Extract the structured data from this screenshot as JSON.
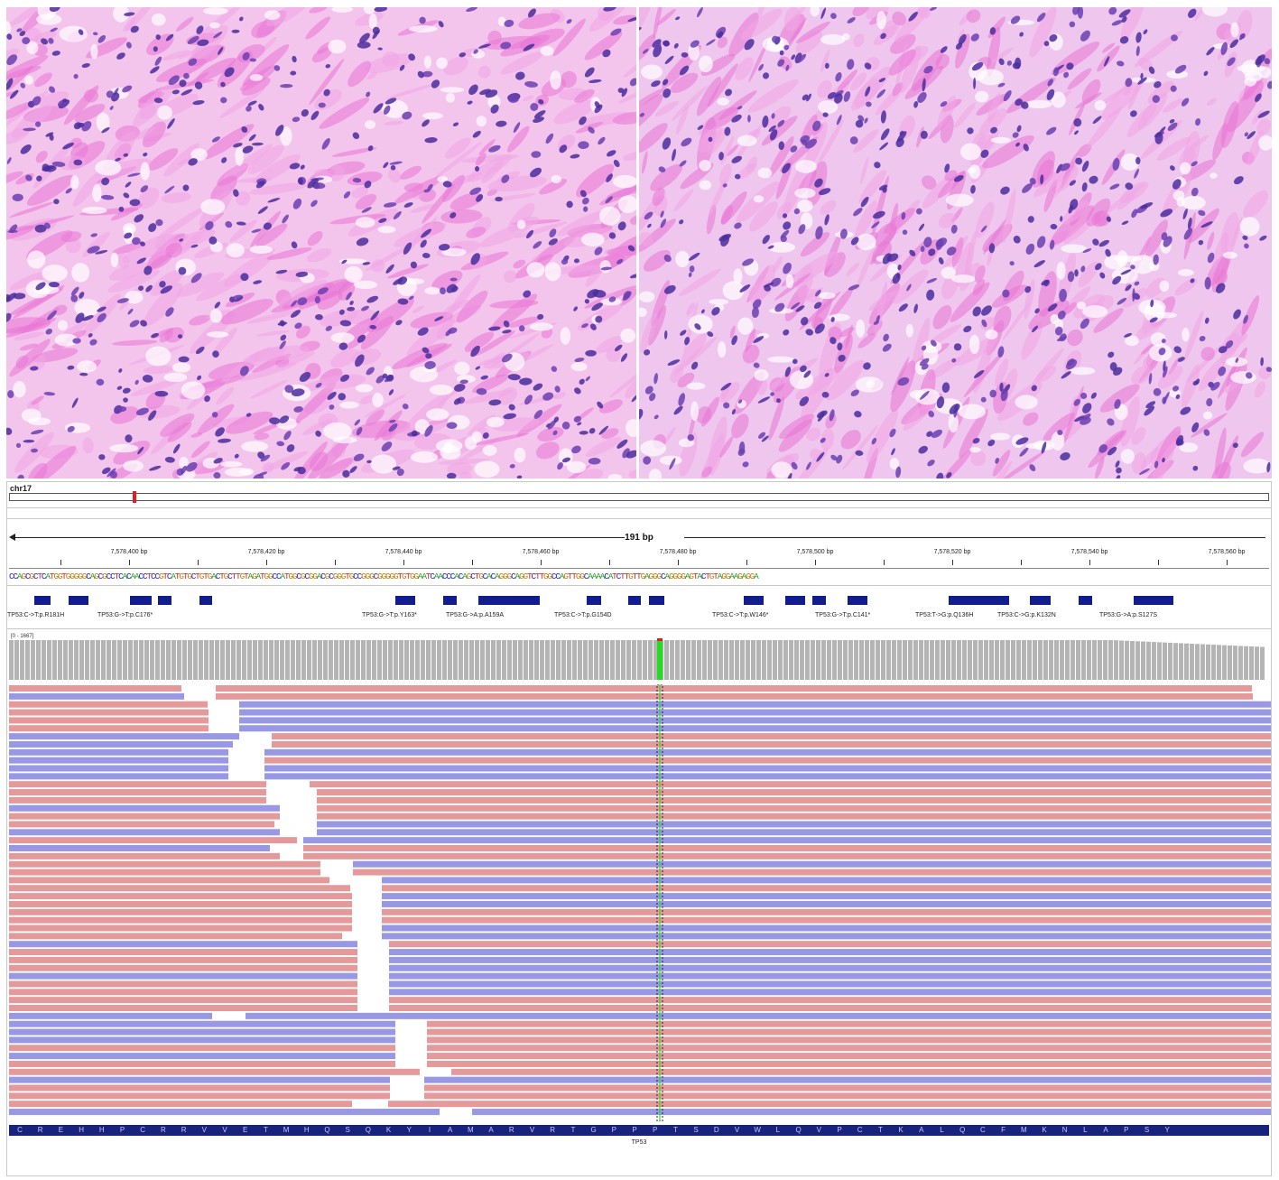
{
  "histology": {
    "left_panel": "H&E histology micrograph (left)",
    "right_panel": "H&E histology micrograph (right)"
  },
  "igv": {
    "chromosome": "chr17",
    "span": "191 bp",
    "ruler_ticks": [
      "7,578,400 bp",
      "7,578,420 bp",
      "7,578,440 bp",
      "7,578,460 bp",
      "7,578,480 bp",
      "7,578,500 bp",
      "7,578,520 bp",
      "7,578,540 bp",
      "7,578,560 bp"
    ],
    "sequence": "CCAGCGCTCATGGTGGGGGCAGCGCCTCACAACCTCCGTCATGTGCTGTGACTGCTTGTAGATGGCCATGGCGCGGACGCGGGTGCCGGGCGGGGGTGTGGAATCAACCCACAGCTGCACAGGGCAGGTCTTGGCCAGTTGGCAAAACATCTTGTTGAGGGCAGGGGAGTACTGTAGGAAGAGGA",
    "coverage_range": "[0 - 1667]",
    "variant_annotations": [
      "TP53:C->T:p.R181H",
      "TP53:G->T:p.C176*",
      "TP53:G->T:p.Y163*",
      "TP53:G->A:p.A159A",
      "TP53:C->T:p.G154D",
      "TP53:C->T:p.W146*",
      "TP53:G->T:p.C141*",
      "TP53:T->G:p.Q136H",
      "TP53:C->G:p.K132N",
      "TP53:G->A:p.S127S"
    ],
    "amino_acids": [
      "C",
      "R",
      "E",
      "H",
      "H",
      "P",
      "C",
      "R",
      "R",
      "V",
      "V",
      "E",
      "T",
      "M",
      "H",
      "Q",
      "S",
      "Q",
      "K",
      "Y",
      "I",
      "A",
      "M",
      "A",
      "R",
      "V",
      "R",
      "T",
      "G",
      "P",
      "P",
      "P",
      "T",
      "S",
      "D",
      "V",
      "W",
      "L",
      "Q",
      "V",
      "P",
      "C",
      "T",
      "K",
      "A",
      "L",
      "Q",
      "C",
      "F",
      "M",
      "K",
      "N",
      "L",
      "A",
      "P",
      "S",
      "Y"
    ],
    "gene": "TP53",
    "colors": {
      "forward_read": "#e49a9a",
      "reverse_read": "#9898e4",
      "feature": "#111d8f",
      "coverage": "#b4b4b4",
      "variant_highlight": "#22dd22",
      "variant_marker": "#e02020"
    }
  }
}
